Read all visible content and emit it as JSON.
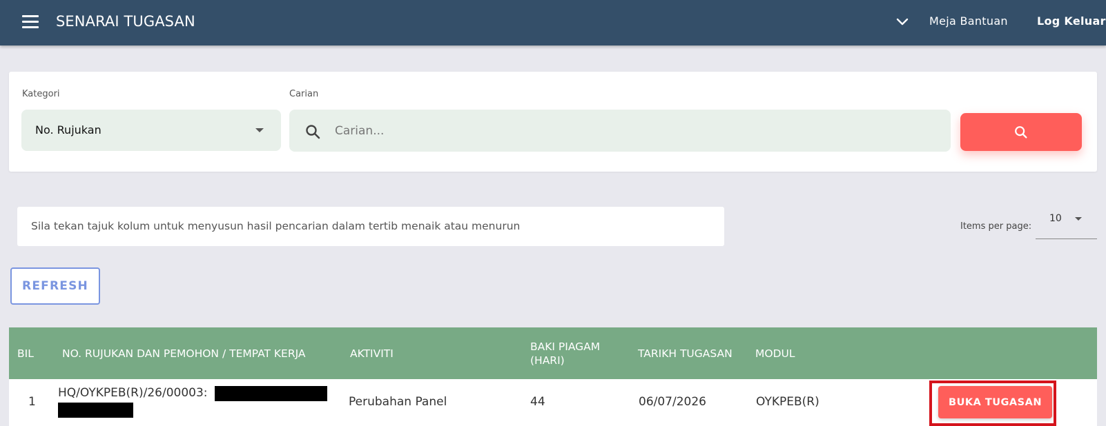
{
  "header": {
    "title": "SENARAI TUGASAN",
    "help_label": "Meja Bantuan",
    "logout_label": "Log Keluar",
    "bg_color": "#344f69"
  },
  "filter": {
    "category_label": "Kategori",
    "category_value": "No. Rujukan",
    "search_label": "Carian",
    "search_placeholder": "Carian...",
    "search_value": "",
    "accent_color": "#ff5e5a"
  },
  "info": {
    "sort_hint": "Sila tekan tajuk kolum untuk menyusun hasil pencarian dalam tertib menaik atau menurun",
    "items_per_page_label": "Items per page:",
    "items_per_page_value": "10"
  },
  "toolbar": {
    "refresh_label": "REFRESH"
  },
  "table": {
    "header_color": "#78aa85",
    "columns": [
      "BIL",
      "NO. RUJUKAN DAN PEMOHON / TEMPAT KERJA",
      "AKTIVITI",
      "BAKI PIAGAM (HARI)",
      "TARIKH TUGASAN",
      "MODUL"
    ],
    "rows": [
      {
        "bil": "1",
        "rujukan": "HQ/OYKPEB(R)/26/00003:",
        "aktiviti": "Perubahan Panel",
        "baki": "44",
        "tarikh": "06/07/2026",
        "modul": "OYKPEB(R)",
        "action_label": "BUKA TUGASAN"
      }
    ]
  }
}
